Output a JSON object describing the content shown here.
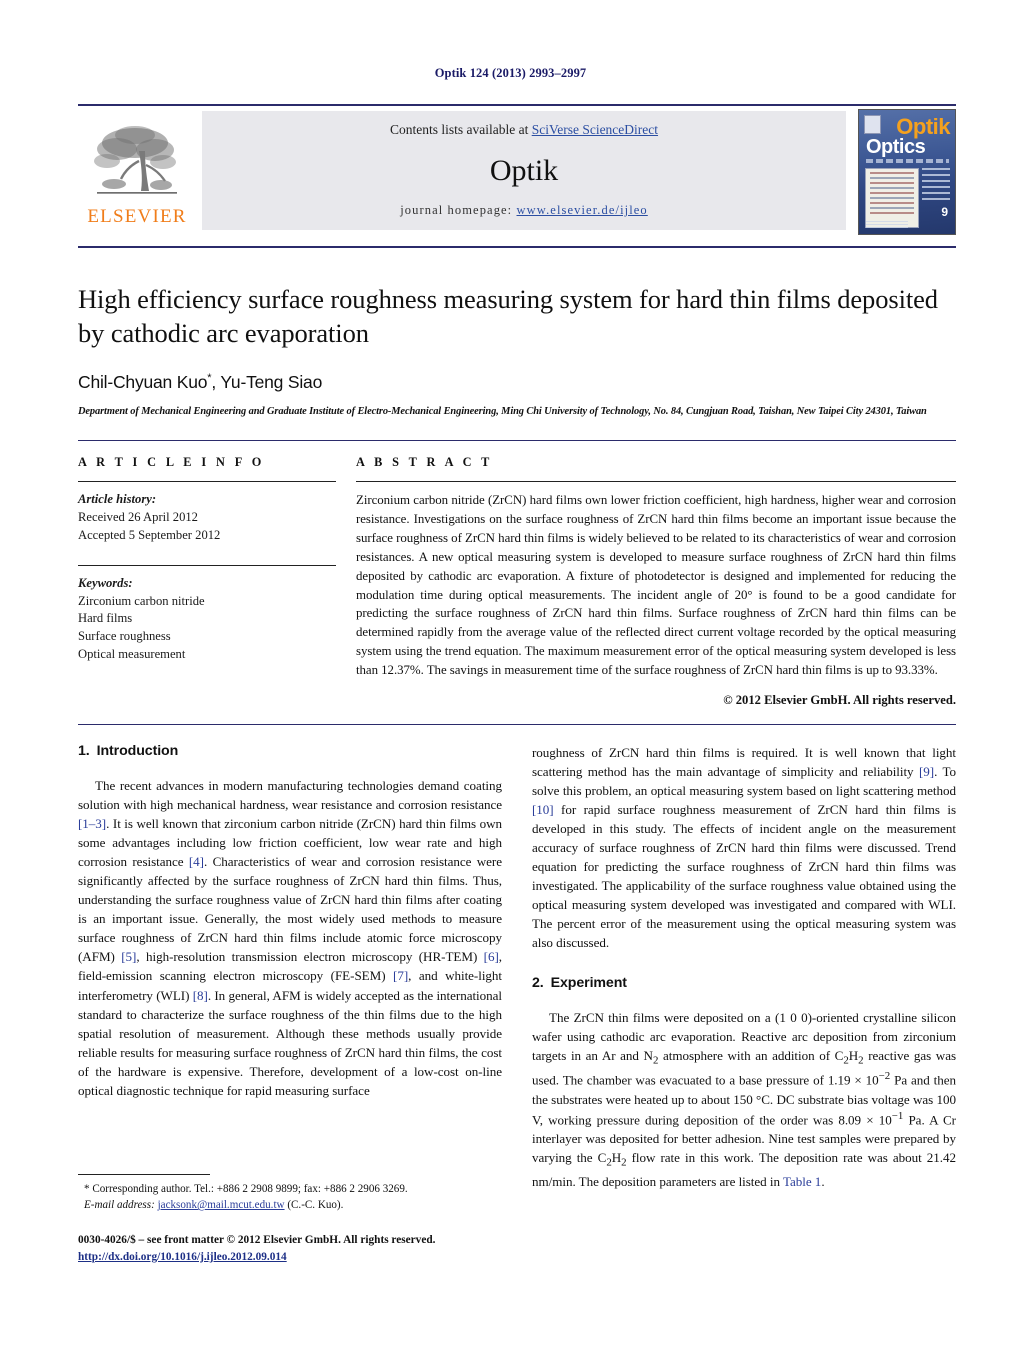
{
  "running_head": "Optik 124 (2013) 2993–2997",
  "masthead": {
    "publisher_logo_text": "ELSEVIER",
    "contents_prefix": "Contents lists available at ",
    "contents_link": "SciVerse ScienceDirect",
    "journal_name": "Optik",
    "homepage_label": "journal homepage:",
    "homepage_url": "www.elsevier.de/ijleo",
    "cover": {
      "title_primary": "Optik",
      "title_secondary": "Optics",
      "issue_number": "9"
    },
    "accent_orange": "#f07d1a",
    "link_blue": "#2b4ea2"
  },
  "article": {
    "title": "High efficiency surface roughness measuring system for hard thin films deposited by cathodic arc evaporation",
    "authors": "Chil-Chyuan Kuo",
    "author_marker": "*",
    "authors_rest": ", Yu-Teng Siao",
    "affiliation": "Department of Mechanical Engineering and Graduate Institute of Electro-Mechanical Engineering, Ming Chi University of Technology, No. 84, Cungjuan Road, Taishan, New Taipei City 24301, Taiwan"
  },
  "article_info": {
    "heading": "A R T I C L E  I N F O",
    "history_label": "Article history:",
    "received": "Received 26 April 2012",
    "accepted": "Accepted 5 September 2012",
    "keywords_label": "Keywords:",
    "keywords": [
      "Zirconium carbon nitride",
      "Hard films",
      "Surface roughness",
      "Optical measurement"
    ]
  },
  "abstract": {
    "heading": "A B S T R A C T",
    "text": "Zirconium carbon nitride (ZrCN) hard films own lower friction coefficient, high hardness, higher wear and corrosion resistance. Investigations on the surface roughness of ZrCN hard thin films become an important issue because the surface roughness of ZrCN hard thin films is widely believed to be related to its characteristics of wear and corrosion resistances. A new optical measuring system is developed to measure surface roughness of ZrCN hard thin films deposited by cathodic arc evaporation. A fixture of photodetector is designed and implemented for reducing the modulation time during optical measurements. The incident angle of 20° is found to be a good candidate for predicting the surface roughness of ZrCN hard thin films. Surface roughness of ZrCN hard thin films can be determined rapidly from the average value of the reflected direct current voltage recorded by the optical measuring system using the trend equation. The maximum measurement error of the optical measuring system developed is less than 12.37%. The savings in measurement time of the surface roughness of ZrCN hard thin films is up to 93.33%.",
    "copyright": "© 2012 Elsevier GmbH. All rights reserved."
  },
  "sections": {
    "introduction": {
      "number": "1.",
      "title": "Introduction",
      "para_left_1": "The recent advances in modern manufacturing technologies demand coating solution with high mechanical hardness, wear resistance and corrosion resistance ",
      "ref_1_3": "[1–3]",
      "para_left_2": ". It is well known that zirconium carbon nitride (ZrCN) hard thin films own some advantages including low friction coefficient, low wear rate and high corrosion resistance ",
      "ref_4": "[4]",
      "para_left_3": ". Characteristics of wear and corrosion resistance were significantly affected by the surface roughness of ZrCN hard thin films. Thus, understanding the surface roughness value of ZrCN hard thin films after coating is an important issue. Generally, the most widely used methods to measure surface roughness of ZrCN hard thin films include atomic force microscopy (AFM) ",
      "ref_5": "[5]",
      "para_left_4": ", high-resolution transmission electron microscopy (HR-TEM) ",
      "ref_6": "[6]",
      "para_left_5": ", field-emission scanning electron microscopy (FE-SEM) ",
      "ref_7": "[7]",
      "para_left_6": ", and white-light interferometry (WLI) ",
      "ref_8": "[8]",
      "para_left_7": ". In general, AFM is widely accepted as the international standard to characterize the surface roughness of the thin films due to the high spatial resolution of measurement. Although these methods usually provide reliable results for measuring surface roughness of ZrCN hard thin films, the cost of the hardware is expensive. Therefore, development of a low-cost on-line optical diagnostic technique for rapid measuring surface",
      "para_right_1": "roughness of ZrCN hard thin films is required. It is well known that light scattering method has the main advantage of simplicity and reliability ",
      "ref_9": "[9]",
      "para_right_2": ". To solve this problem, an optical measuring system based on light scattering method ",
      "ref_10": "[10]",
      "para_right_3": " for rapid surface roughness measurement of ZrCN hard thin films is developed in this study. The effects of incident angle on the measurement accuracy of surface roughness of ZrCN hard thin films were discussed. Trend equation for predicting the surface roughness of ZrCN hard thin films was investigated. The applicability of the surface roughness value obtained using the optical measuring system developed was investigated and compared with WLI. The percent error of the measurement using the optical measuring system was also discussed."
    },
    "experiment": {
      "number": "2.",
      "title": "Experiment",
      "p1_a": "The ZrCN thin films were deposited on a (1 0 0)-oriented crystalline silicon wafer using cathodic arc evaporation. Reactive arc deposition from zirconium targets in an Ar and N",
      "sub_n2": "2",
      "p1_b": " atmosphere with an addition of C",
      "sub_c2": "2",
      "p1_c": "H",
      "sub_h2": "2",
      "p1_d": " reactive gas was used. The chamber was evacuated to a base pressure of 1.19 × 10",
      "sup_m2": "−2",
      "p1_e": " Pa and then the substrates were heated up to about 150 °C. DC substrate bias voltage was 100 V, working pressure during deposition of the order was 8.09 × 10",
      "sup_m1": "−1",
      "p1_f": " Pa. A Cr interlayer was deposited for better adhesion. Nine test samples were prepared by varying the C",
      "sub_c2b": "2",
      "p1_g": "H",
      "sub_h2b": "2",
      "p1_h": " flow rate in this work. The deposition rate was about 21.42 nm/min. The deposition parameters are listed in ",
      "table_ref": "Table 1",
      "p1_i": "."
    }
  },
  "footnote": {
    "marker": "*",
    "line1": " Corresponding author. Tel.: +886 2 2908 9899; fax: +886 2 2906 3269.",
    "email_label": "E-mail address:",
    "email": "jacksonk@mail.mcut.edu.tw",
    "email_suffix": " (C.-C. Kuo)."
  },
  "page_footer": {
    "issn_line": "0030-4026/$ – see front matter © 2012 Elsevier GmbH. All rights reserved.",
    "doi": "http://dx.doi.org/10.1016/j.ijleo.2012.09.014"
  }
}
